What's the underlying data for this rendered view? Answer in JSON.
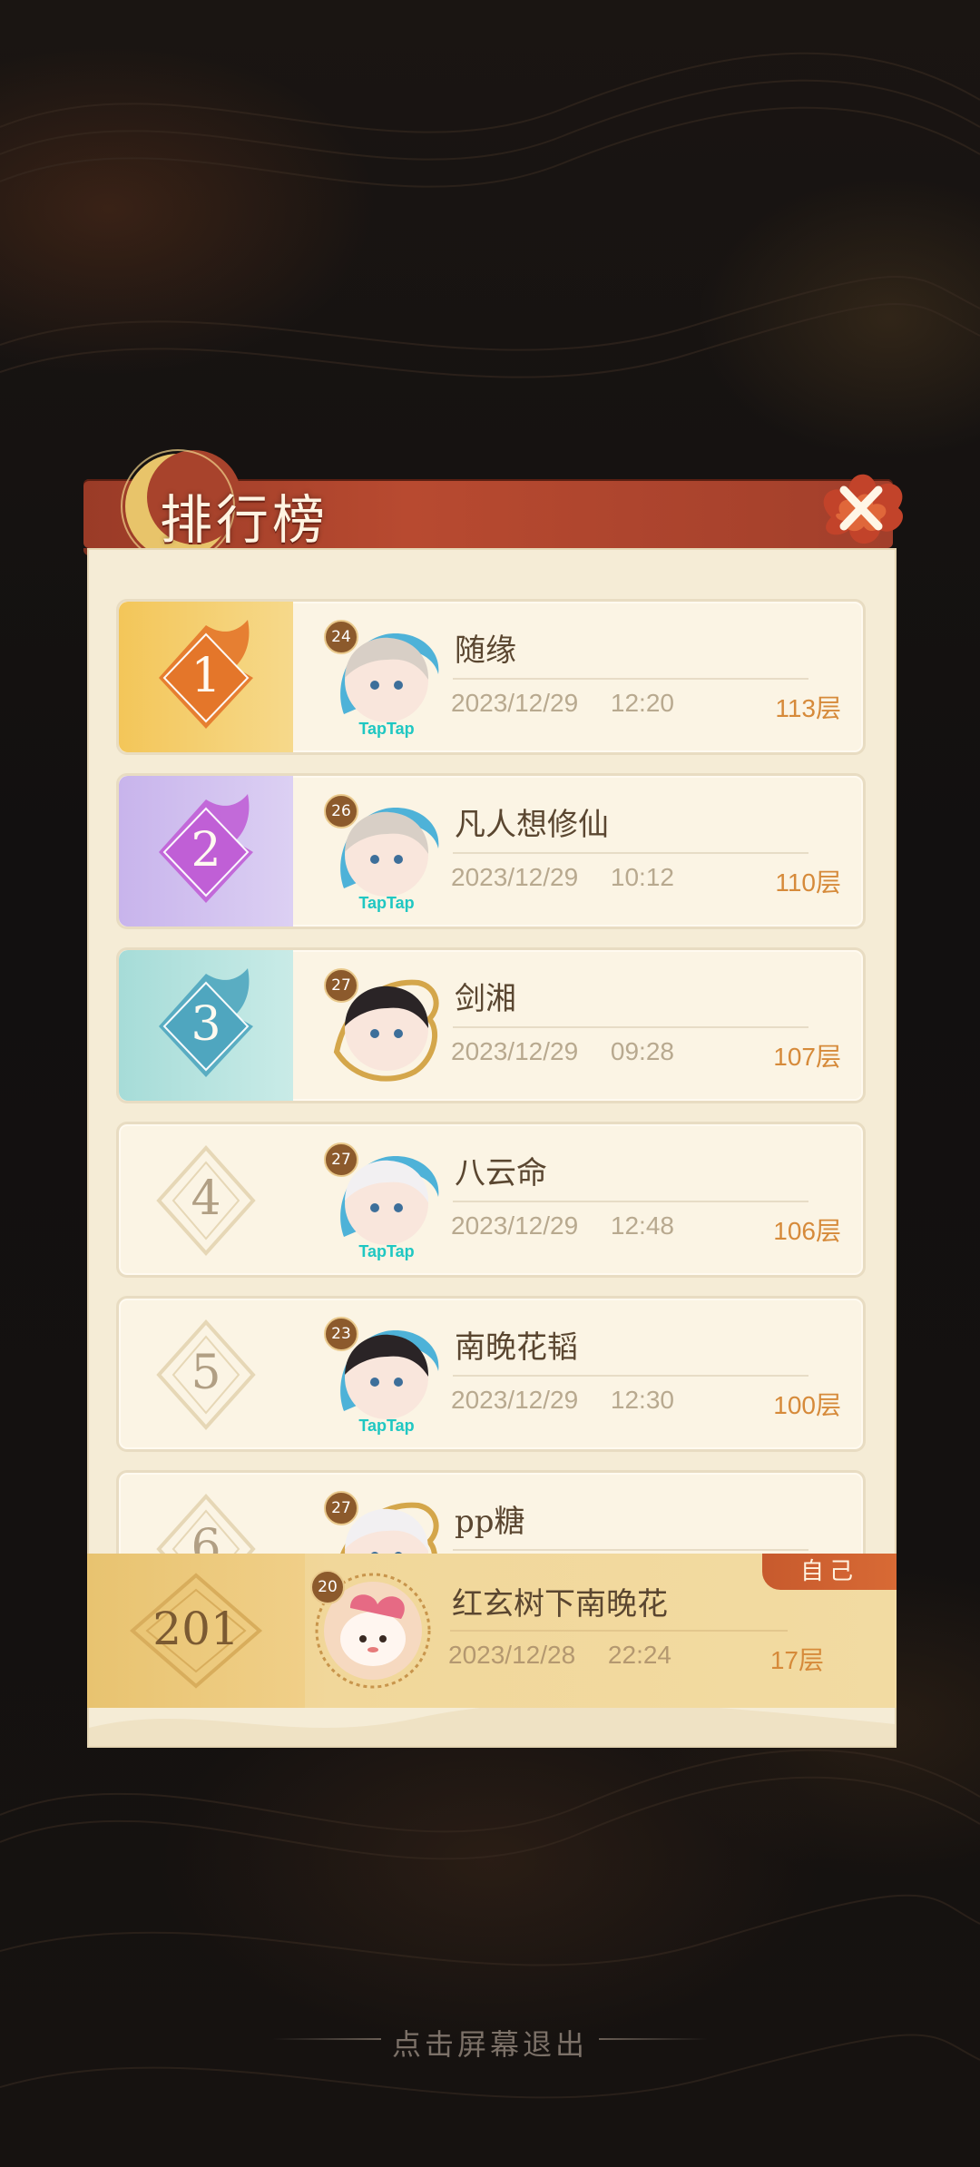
{
  "title": "排行榜",
  "rows": [
    {
      "rank": "1",
      "level": "24",
      "name": "随缘",
      "date": "2023/12/29",
      "time": "12:20",
      "floor": "113层",
      "avatar": "girl-silver-hair-taptap",
      "theme": "gold"
    },
    {
      "rank": "2",
      "level": "26",
      "name": "凡人想修仙",
      "date": "2023/12/29",
      "time": "10:12",
      "floor": "110层",
      "avatar": "girl-silver-hair-taptap",
      "theme": "purple"
    },
    {
      "rank": "3",
      "level": "27",
      "name": "剑湘",
      "date": "2023/12/29",
      "time": "09:28",
      "floor": "107层",
      "avatar": "man-dark-hair-dragon-frame",
      "theme": "teal"
    },
    {
      "rank": "4",
      "level": "27",
      "name": "八云命",
      "date": "2023/12/29",
      "time": "12:48",
      "floor": "106层",
      "avatar": "white-hair-mask-taptap",
      "theme": "plain"
    },
    {
      "rank": "5",
      "level": "23",
      "name": "南晚花韬",
      "date": "2023/12/29",
      "time": "12:30",
      "floor": "100层",
      "avatar": "boy-dark-hair-taptap",
      "theme": "plain"
    },
    {
      "rank": "6",
      "level": "27",
      "name": "pp糖",
      "date": "",
      "time": "",
      "floor": "",
      "avatar": "white-hair-mask-dragon-frame",
      "theme": "plain"
    }
  ],
  "self": {
    "rank": "201",
    "level": "20",
    "name": "红玄树下南晚花",
    "date": "2023/12/28",
    "time": "22:24",
    "floor": "17层",
    "tag": "自己",
    "avatar": "pink-spirit-pet"
  },
  "exit_hint": "点击屏幕退出",
  "colors": {
    "gold": "#f0c25a",
    "purple": "#c9b7ea",
    "teal": "#a9dcda",
    "accent": "#d68a3a",
    "banner": "#b84a30"
  }
}
